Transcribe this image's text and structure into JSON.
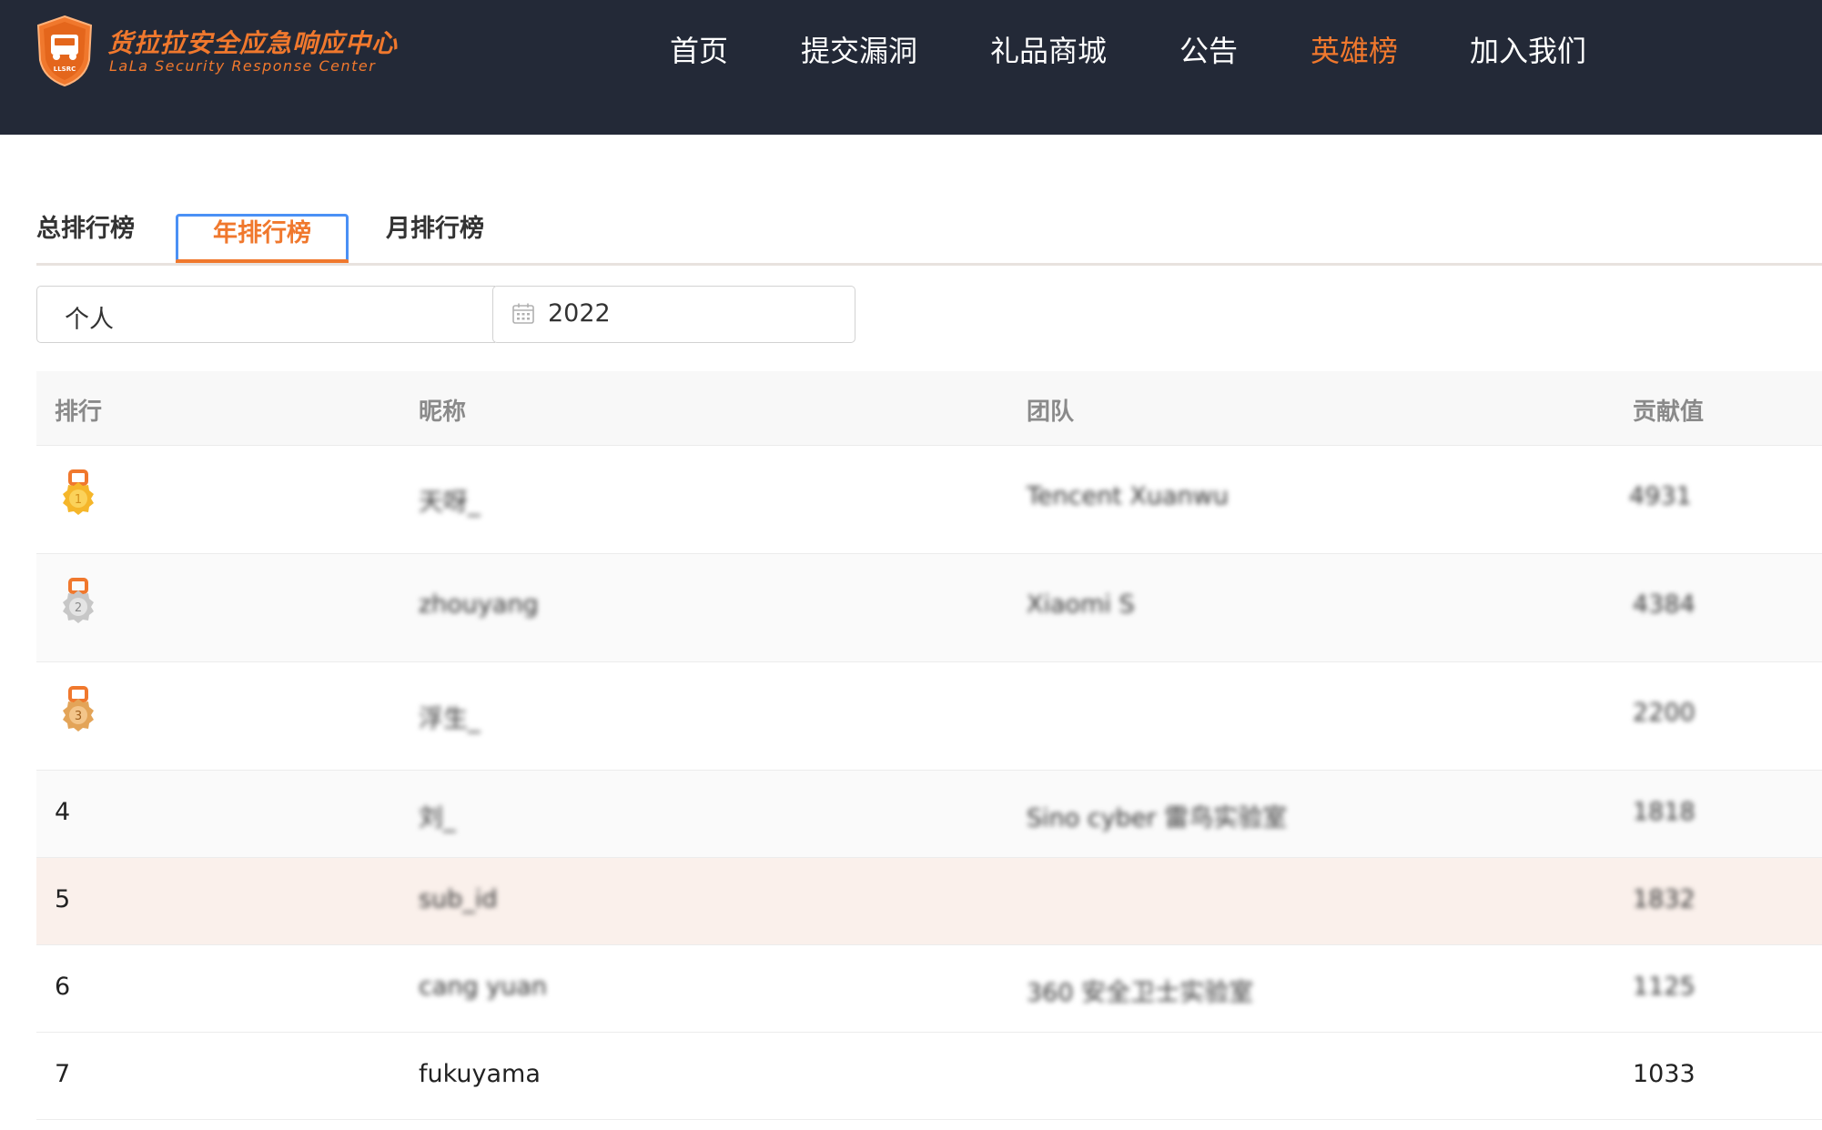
{
  "header": {
    "logo_title": "货拉拉安全应急响应中心",
    "logo_subtitle": "LaLa Security Response Center",
    "logo_badge": "LLSRC",
    "nav": [
      {
        "label": "首页",
        "active": false
      },
      {
        "label": "提交漏洞",
        "active": false
      },
      {
        "label": "礼品商城",
        "active": false
      },
      {
        "label": "公告",
        "active": false
      },
      {
        "label": "英雄榜",
        "active": true
      },
      {
        "label": "加入我们",
        "active": false
      }
    ]
  },
  "tabs": [
    {
      "label": "总排行榜",
      "active": false
    },
    {
      "label": "年排行榜",
      "active": true
    },
    {
      "label": "月排行榜",
      "active": false
    }
  ],
  "filters": {
    "type_value": "个人",
    "year_value": "2022",
    "year_icon": "calendar-icon"
  },
  "table": {
    "headers": [
      "排行",
      "昵称",
      "团队",
      "贡献值"
    ],
    "rows": [
      {
        "rank": "1",
        "medal": "gold",
        "nickname": "天呀_",
        "team": "Tencent Xuanwu",
        "score": "4931"
      },
      {
        "rank": "2",
        "medal": "silver",
        "nickname": "zhouyang",
        "team": "Xiaomi S",
        "score": "4384"
      },
      {
        "rank": "3",
        "medal": "bronze",
        "nickname": "浮生_",
        "team": "",
        "score": "2200"
      },
      {
        "rank": "4",
        "medal": "",
        "nickname": "刘_",
        "team": "Sino cyber 雷鸟实验室",
        "score": "1818"
      },
      {
        "rank": "5",
        "medal": "",
        "nickname": "sub_id",
        "team": "",
        "score": "1832"
      },
      {
        "rank": "6",
        "medal": "",
        "nickname": "cang yuan",
        "team": "360 安全卫士实验室",
        "score": "1125"
      },
      {
        "rank": "7",
        "medal": "",
        "nickname": "fukuyama",
        "team": "",
        "score": "1033"
      }
    ]
  },
  "colors": {
    "accent": "#f0782d",
    "header_bg": "#232937",
    "gold": "#f5b62a",
    "silver": "#c7c7c7",
    "bronze": "#e3a458"
  }
}
